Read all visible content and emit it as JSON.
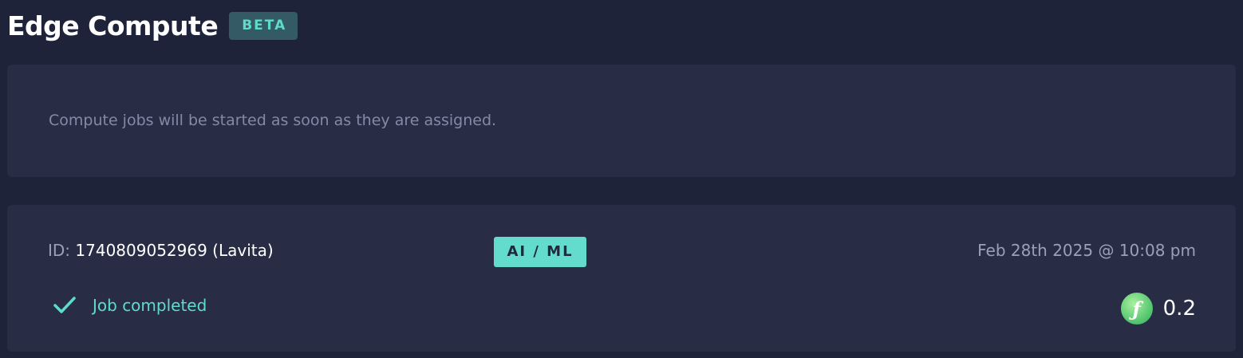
{
  "header": {
    "title": "Edge Compute",
    "badge": "BETA"
  },
  "info": {
    "message": "Compute jobs will be started as soon as they are assigned."
  },
  "job": {
    "id_label": "ID:",
    "id_value": "1740809052969 (Lavita)",
    "category": "AI / ML",
    "timestamp": "Feb 28th 2025 @ 10:08 pm",
    "status": "Job completed",
    "status_icon": "check-icon",
    "reward_icon": "token-icon",
    "reward_icon_glyph": "ƒ",
    "reward_value": "0.2"
  },
  "colors": {
    "background": "#1f233a",
    "card": "#282d45",
    "accent": "#5fdbc9",
    "badge_bg": "#345a66",
    "category_bg": "#63dccd",
    "token_green": "#4fc26b"
  }
}
